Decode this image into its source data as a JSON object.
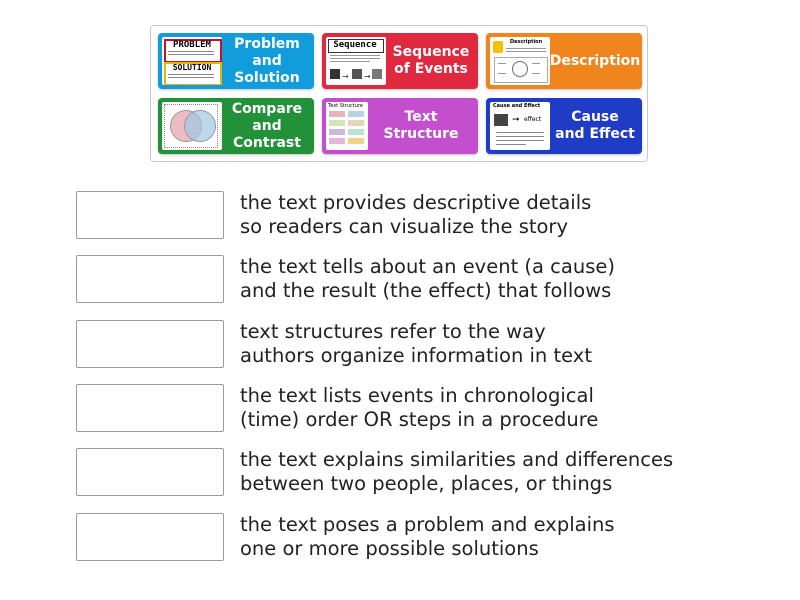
{
  "colors": {
    "red": "#e0283e",
    "orange": "#f0851e",
    "green": "#23913a",
    "purple": "#c44fce",
    "blue": "#1f3cc6"
  },
  "tiles": [
    {
      "label": "Problem\nand\nSolution",
      "color": "#119ddb",
      "thumb": "problem-solution-thumbnail",
      "thumb_text": [
        "PROBLEM",
        "SOLUTION"
      ]
    },
    {
      "label": "Sequence\nof Events",
      "color": "#e0283e",
      "thumb": "sequence-thumbnail",
      "thumb_text": [
        "Sequence"
      ]
    },
    {
      "label": "Description",
      "color": "#f0851e",
      "thumb": "description-thumbnail",
      "thumb_text": [
        "Description"
      ]
    },
    {
      "label": "Compare\nand\nContrast",
      "color": "#23913a",
      "thumb": "compare-contrast-thumbnail",
      "thumb_text": []
    },
    {
      "label": "Text Structure",
      "color": "#c44fce",
      "thumb": "text-structure-thumbnail",
      "thumb_text": [
        "Text Structure"
      ]
    },
    {
      "label": "Cause\nand Effect",
      "color": "#1f3cc6",
      "thumb": "cause-effect-thumbnail",
      "thumb_text": [
        "Cause and Effect",
        "effect"
      ]
    }
  ],
  "rows": [
    {
      "text": "the text provides descriptive details\nso readers can visualize the story"
    },
    {
      "text": "the text tells about an event (a cause)\nand the result (the effect) that follows"
    },
    {
      "text": "text structures refer to the way\nauthors organize information in text"
    },
    {
      "text": "the text lists events in chronological\n(time) order OR steps in a procedure"
    },
    {
      "text": "the text explains similarities and differences\nbetween two people, places, or things"
    },
    {
      "text": "the text poses a problem and explains\none or more possible solutions"
    }
  ]
}
